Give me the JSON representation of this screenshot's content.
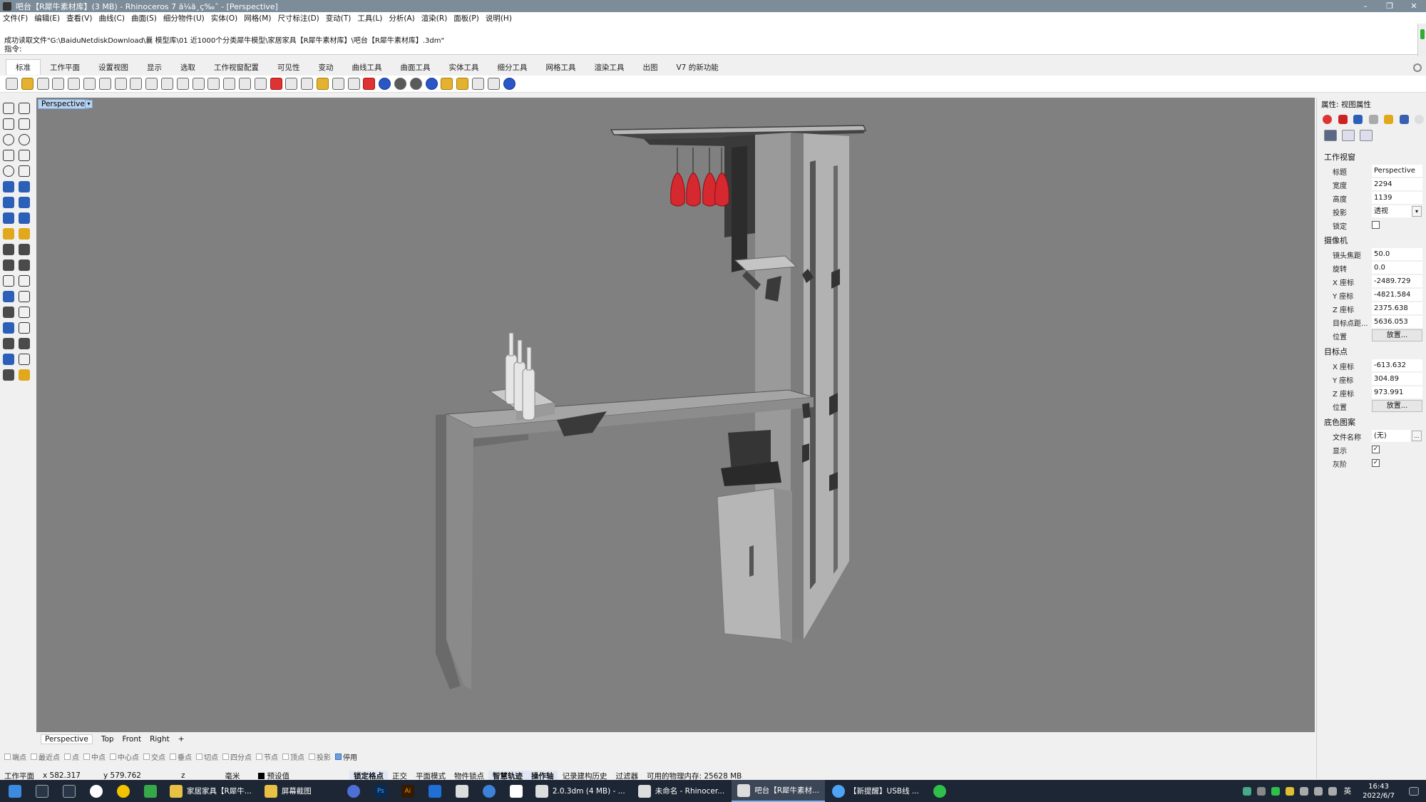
{
  "window": {
    "title": "吧台【R犀牛素材库】(3 MB) - Rhinoceros 7 ä¼ä¸ç‰ˆ - [Perspective]",
    "minimize": "–",
    "maximize": "❐",
    "close": "✕"
  },
  "menu": [
    "文件(F)",
    "编辑(E)",
    "查看(V)",
    "曲线(C)",
    "曲面(S)",
    "细分物件(U)",
    "实体(O)",
    "网格(M)",
    "尺寸标注(D)",
    "变动(T)",
    "工具(L)",
    "分析(A)",
    "渲染(R)",
    "面板(P)",
    "说明(H)"
  ],
  "command": {
    "history_line": "成功读取文件\"G:\\BaiduNetdiskDownload\\曩 模型库\\01 近1000个分类犀牛模型\\家居家具【R犀牛素材库】\\吧台【R犀牛素材库】.3dm\"",
    "prompt": "指令:"
  },
  "tabs": [
    "标准",
    "工作平面",
    "设置视图",
    "显示",
    "选取",
    "工作视窗配置",
    "可见性",
    "变动",
    "曲线工具",
    "曲面工具",
    "实体工具",
    "细分工具",
    "网格工具",
    "渲染工具",
    "出图",
    "V7 的新功能"
  ],
  "viewport": {
    "label": "Perspective",
    "arrow": "▾",
    "background": "#808080"
  },
  "viewport_tabs": [
    "Perspective",
    "Top",
    "Front",
    "Right",
    "+"
  ],
  "osnaps": [
    {
      "label": "端点",
      "on": false
    },
    {
      "label": "最近点",
      "on": false
    },
    {
      "label": "点",
      "on": false
    },
    {
      "label": "中点",
      "on": false
    },
    {
      "label": "中心点",
      "on": false
    },
    {
      "label": "交点",
      "on": false
    },
    {
      "label": "垂点",
      "on": false
    },
    {
      "label": "切点",
      "on": false
    },
    {
      "label": "四分点",
      "on": false
    },
    {
      "label": "节点",
      "on": false
    },
    {
      "label": "顶点",
      "on": false
    },
    {
      "label": "投影",
      "on": false
    },
    {
      "label": "停用",
      "on": true
    }
  ],
  "status": {
    "cplane": "工作平面",
    "x": "x 582.317",
    "y": "y 579.762",
    "z": "z",
    "unit": "毫米",
    "layer": "预设值",
    "toggles": [
      "锁定格点",
      "正交",
      "平面模式",
      "物件锁点",
      "智慧轨迹",
      "操作轴",
      "记录建构历史",
      "过滤器"
    ],
    "bold_toggles": [
      "智慧轨迹",
      "操作轴"
    ],
    "memory": "可用的物理内存: 25628 MB"
  },
  "properties": {
    "title": "属性: 视图属性",
    "section_viewport": "工作视窗",
    "title_label": "标题",
    "title_value": "Perspective",
    "width_label": "宽度",
    "width_value": "2294",
    "height_label": "高度",
    "height_value": "1139",
    "projection_label": "投影",
    "projection_value": "透视",
    "lock_label": "锁定",
    "section_camera": "摄像机",
    "lens_label": "镜头焦距",
    "lens_value": "50.0",
    "rotation_label": "旋转",
    "rotation_value": "0.0",
    "cam_x_label": "X 座标",
    "cam_x_value": "-2489.729",
    "cam_y_label": "Y 座标",
    "cam_y_value": "-4821.584",
    "cam_z_label": "Z 座标",
    "cam_z_value": "2375.638",
    "target_dist_label": "目标点距...",
    "target_dist_value": "5636.053",
    "cam_pos_label": "位置",
    "place_button": "放置...",
    "section_target": "目标点",
    "tgt_x_label": "X 座标",
    "tgt_x_value": "-613.632",
    "tgt_y_label": "Y 座标",
    "tgt_y_value": "304.89",
    "tgt_z_label": "Z 座标",
    "tgt_z_value": "973.991",
    "tgt_pos_label": "位置",
    "section_wallpaper": "底色图案",
    "filename_label": "文件名称",
    "filename_value": "(无)",
    "browse_button": "...",
    "show_label": "显示",
    "gray_label": "灰阶",
    "checked": "✓"
  },
  "taskbar": {
    "apps": [
      {
        "label": "家居家具【R犀牛...",
        "color": "#e8c046"
      },
      {
        "label": "屏幕截图",
        "color": "#e8c046"
      },
      {
        "label": "2.0.3dm (4 MB) - ...",
        "color": "#dcdcdc"
      },
      {
        "label": "未命名 - Rhinocer...",
        "color": "#dcdcdc"
      },
      {
        "label": "吧台【R犀牛素材...",
        "color": "#dcdcdc"
      },
      {
        "label": "【新提醒】USB线 ...",
        "color": "#4fa3f7"
      }
    ],
    "time": "16:43",
    "date": "2022/6/7",
    "ime": "英"
  }
}
